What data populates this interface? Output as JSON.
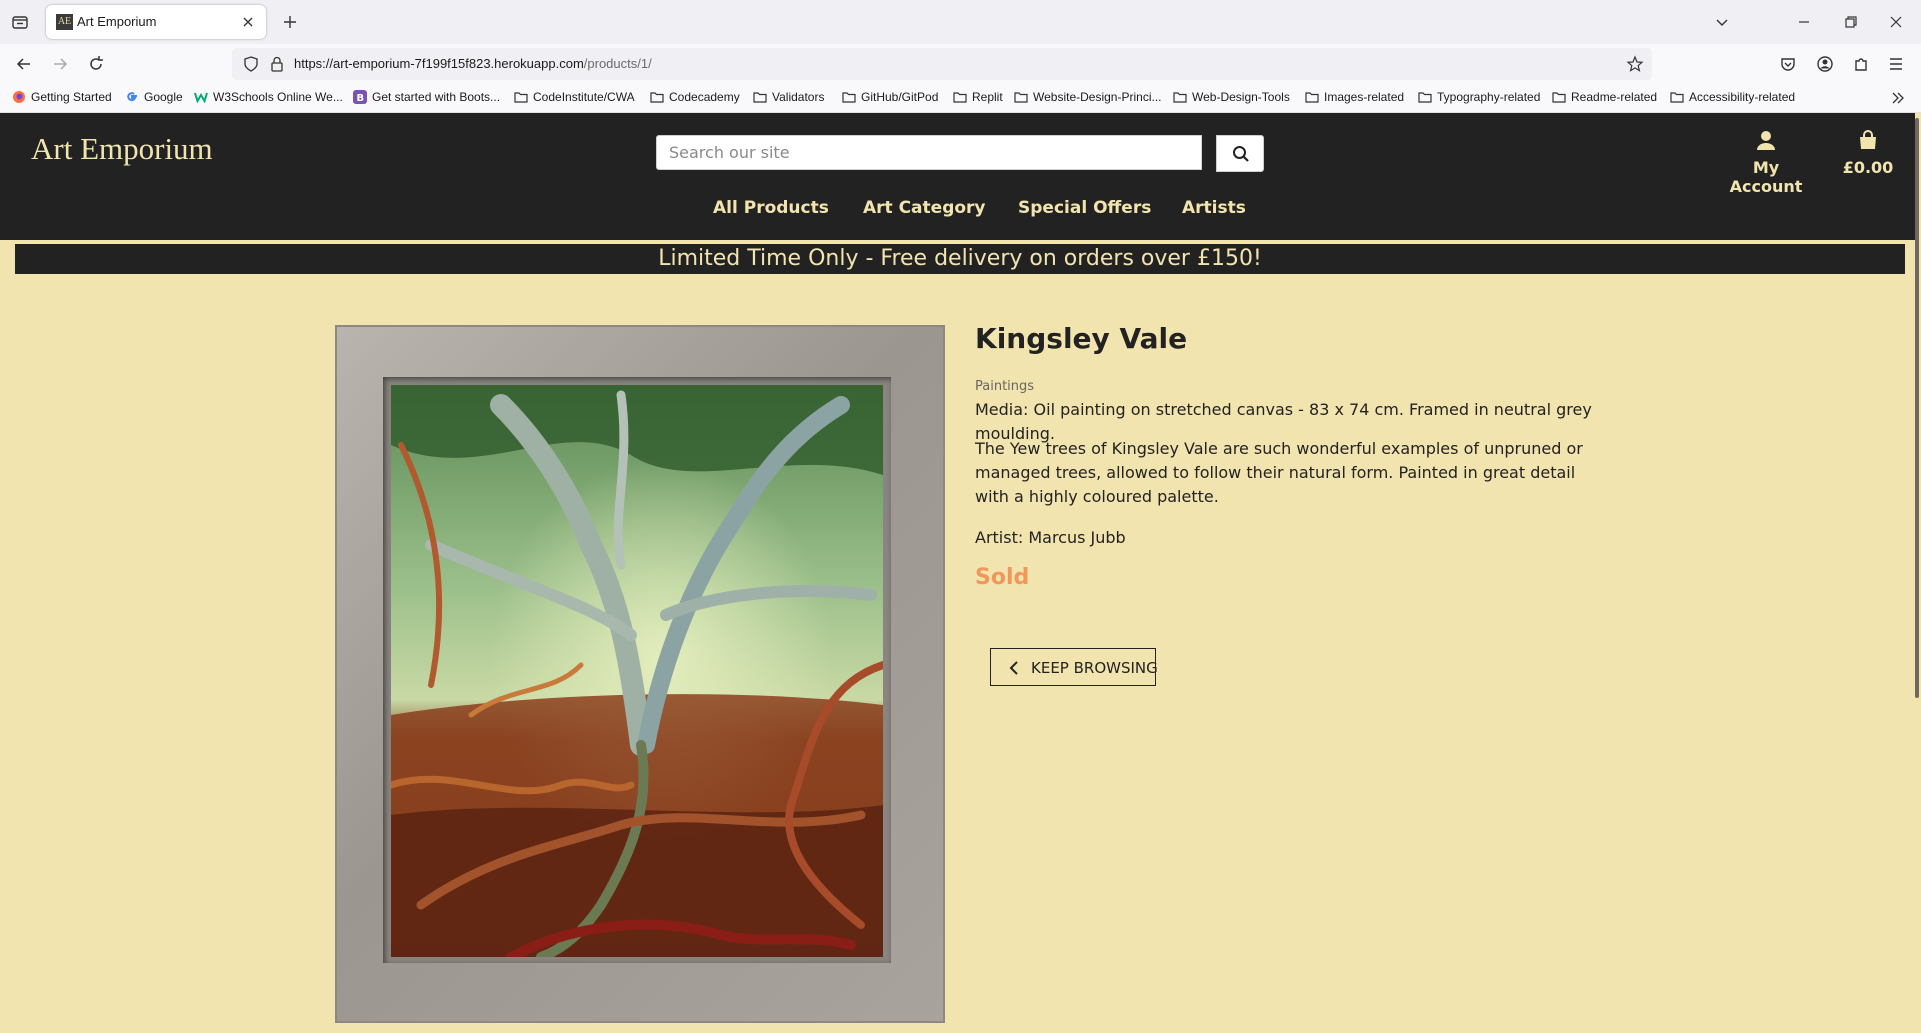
{
  "browser": {
    "tab_title": "Art Emporium",
    "tab_favicon": "AE",
    "url_main": "https://art-emporium-7f199f15f823.herokuapp.com",
    "url_path": "/products/1/",
    "bookmarks": [
      {
        "label": "Getting Started",
        "icon": "firefox-icon"
      },
      {
        "label": "Google",
        "icon": "google-icon"
      },
      {
        "label": "W3Schools Online We...",
        "icon": "w3schools-icon"
      },
      {
        "label": "Get started with Boots...",
        "icon": "bootstrap-icon"
      },
      {
        "label": "CodeInstitute/CWA",
        "icon": "folder-icon"
      },
      {
        "label": "Codecademy",
        "icon": "folder-icon"
      },
      {
        "label": "Validators",
        "icon": "folder-icon"
      },
      {
        "label": "GitHub/GitPod",
        "icon": "folder-icon"
      },
      {
        "label": "Replit",
        "icon": "folder-icon"
      },
      {
        "label": "Website-Design-Princi...",
        "icon": "folder-icon"
      },
      {
        "label": "Web-Design-Tools",
        "icon": "folder-icon"
      },
      {
        "label": "Images-related",
        "icon": "folder-icon"
      },
      {
        "label": "Typography-related",
        "icon": "folder-icon"
      },
      {
        "label": "Readme-related",
        "icon": "folder-icon"
      },
      {
        "label": "Accessibility-related",
        "icon": "folder-icon"
      }
    ]
  },
  "header": {
    "logo": "Art Emporium",
    "search_placeholder": "Search our site",
    "account_label": "My Account",
    "bag_total": "£0.00",
    "nav": [
      "All Products",
      "Art Category",
      "Special Offers",
      "Artists"
    ]
  },
  "promo": "Limited Time Only - Free delivery on orders over £150!",
  "product": {
    "title": "Kingsley Vale",
    "category": "Paintings",
    "media": "Media: Oil painting on stretched canvas - 83 x 74 cm. Framed in neutral grey moulding.",
    "description": "The Yew trees of Kingsley Vale are such wonderful examples of unpruned or managed trees, allowed to follow their natural form. Painted in great detail with a highly coloured palette.",
    "artist": "Artist: Marcus Jubb",
    "status": "Sold",
    "keep_browsing": "Keep Browsing"
  },
  "colors": {
    "page_bg": "#f2e4ae",
    "header_bg": "#222222",
    "accent_text": "#f2e4ae",
    "sold": "#f0985a"
  }
}
